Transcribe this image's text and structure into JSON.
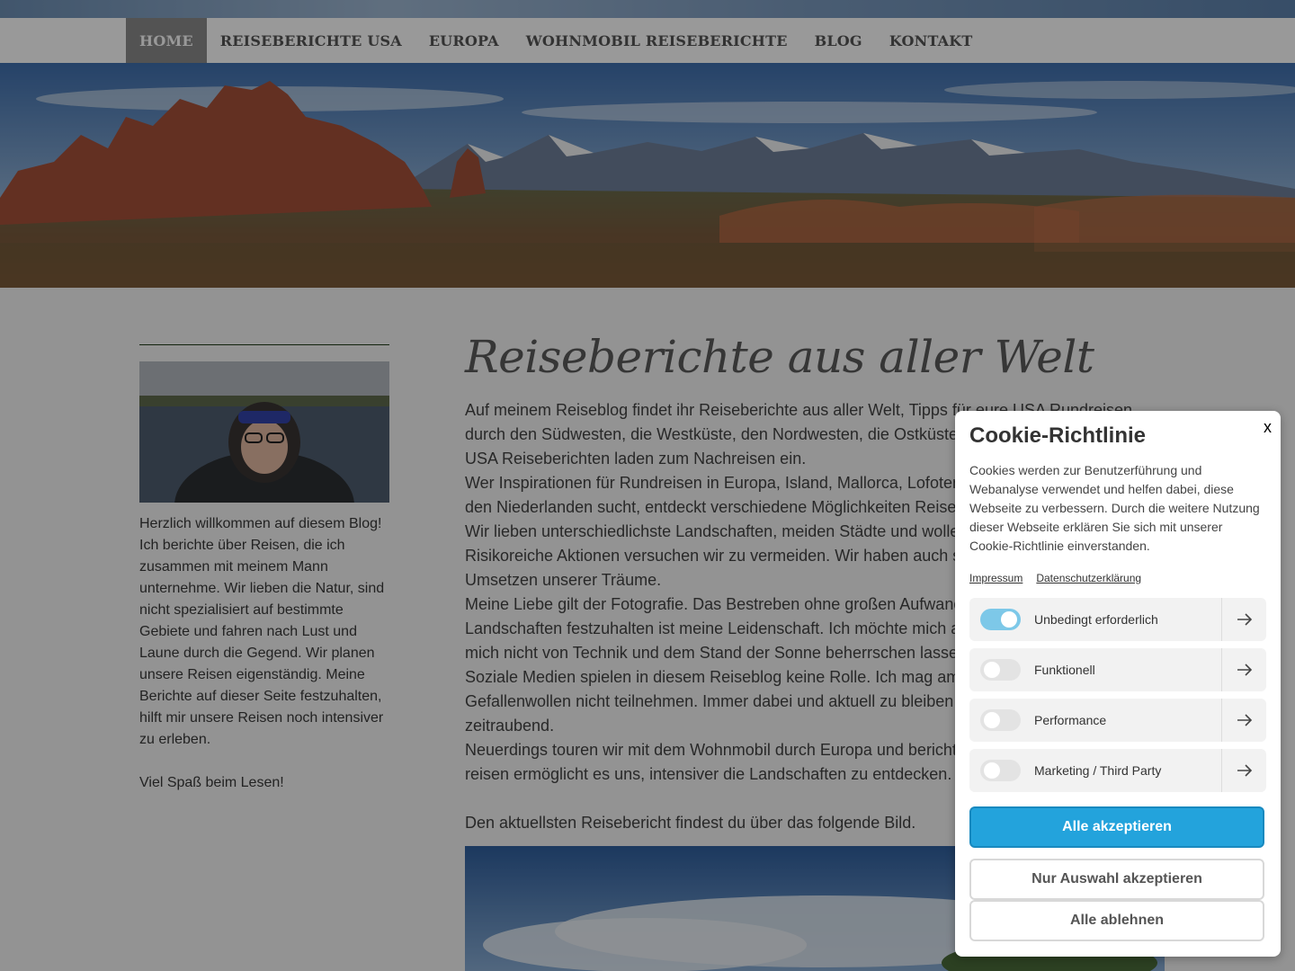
{
  "nav": {
    "items": [
      {
        "label": "HOME"
      },
      {
        "label": "REISEBERICHTE USA"
      },
      {
        "label": "EUROPA"
      },
      {
        "label": "WOHNMOBIL REISEBERICHTE"
      },
      {
        "label": "BLOG"
      },
      {
        "label": "KONTAKT"
      }
    ],
    "active_index": 0
  },
  "sidebar": {
    "intro": "Herzlich willkommen auf diesem Blog! Ich berichte über Reisen, die ich zusammen mit meinem Mann unternehme. Wir lieben die Natur, sind nicht spezialisiert auf bestimmte Gebiete und fahren nach Lust und Laune durch die Gegend. Wir planen unsere Reisen eigenständig. Meine Berichte auf dieser Seite festzuhalten, hilft mir unsere Reisen noch intensiver zu erleben.",
    "outro": "Viel Spaß beim Lesen!"
  },
  "main": {
    "title": "Reiseberichte aus aller Welt",
    "paragraphs": [
      "Auf meinem Reiseblog findet ihr Reiseberichte aus aller Welt, Tipps für eure USA Rundreisen durch den Südwesten, die Westküste, den Nordwesten, die Ostküste",
      "USA Reiseberichten laden zum Nachreisen ein.",
      "Wer Inspirationen für Rundreisen in Europa, Island, Mallorca, Lofoten",
      "den Niederlanden sucht, entdeckt verschiedene Möglichkeiten Reise",
      "Wir lieben unterschiedlichste Landschaften, meiden Städte und wolle",
      "Risikoreiche Aktionen versuchen wir zu vermeiden. Wir haben auch s",
      "Umsetzen unserer Träume.",
      "Meine Liebe gilt der Fotografie. Das Bestreben ohne großen Aufwand",
      "Landschaften festzuhalten ist meine Leidenschaft. Ich möchte mich a",
      "mich nicht von Technik und dem Stand der Sonne beherrschen lasse",
      "Soziale Medien spielen in diesem Reiseblog keine Rolle. Ich mag am",
      "Gefallenwollen nicht teilnehmen. Immer dabei und aktuell zu bleiben",
      "zeitraubend.",
      "Neuerdings touren wir mit dem Wohnmobil durch Europa und bericht",
      "reisen ermöglicht es uns, intensiver die Landschaften zu entdecken."
    ],
    "latest": "Den aktuellsten Reisebericht findest du über das folgende Bild."
  },
  "cookie": {
    "close": "x",
    "title": "Cookie-Richtlinie",
    "description": "Cookies werden zur Benutzerführung und Webanalyse verwendet und helfen dabei, diese Webseite zu verbessern. Durch die weitere Nutzung dieser Webseite erklären Sie sich mit unserer Cookie-Richtlinie einverstanden.",
    "links": {
      "impressum": "Impressum",
      "privacy": "Datenschutzerklärung"
    },
    "categories": [
      {
        "label": "Unbedingt erforderlich",
        "enabled": true
      },
      {
        "label": "Funktionell",
        "enabled": false
      },
      {
        "label": "Performance",
        "enabled": false
      },
      {
        "label": "Marketing / Third Party",
        "enabled": false
      }
    ],
    "buttons": {
      "accept_all": "Alle akzeptieren",
      "accept_selection": "Nur Auswahl akzeptieren",
      "reject_all": "Alle ablehnen"
    }
  },
  "colors": {
    "nav_active_bg": "#8a8a8a",
    "primary_button": "#23a3dc",
    "toggle_on": "#7dc8e8",
    "sidebar_rule": "#1e3b18"
  }
}
